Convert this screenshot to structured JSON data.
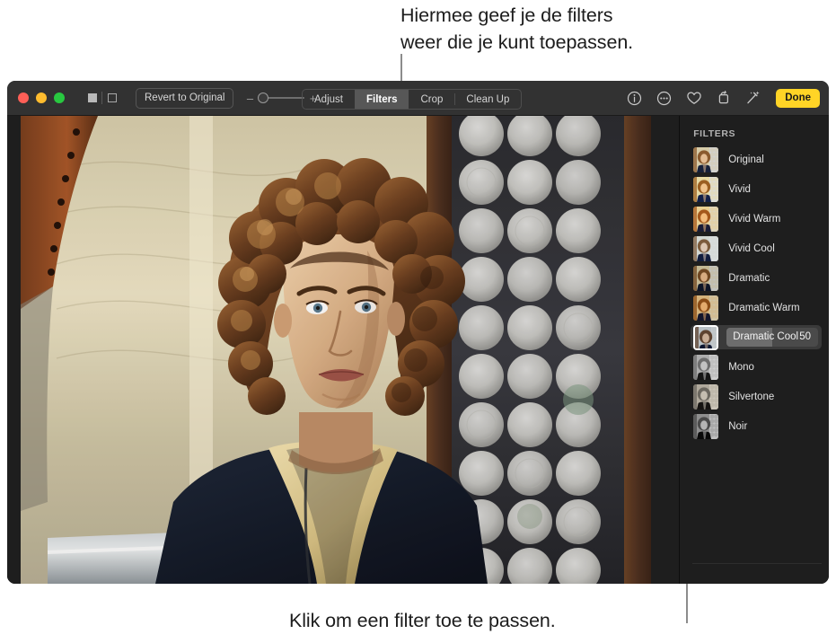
{
  "callouts": {
    "top": "Hiermee geef je de filters\nweer die je kunt toepassen.",
    "bottom": "Klik om een filter toe te passen."
  },
  "window": {
    "traffic_lights": {
      "close_label": "close",
      "minimize_label": "minimize",
      "zoom_label": "zoom"
    },
    "toolbar": {
      "view_single_label": "single-view",
      "view_split_label": "split-view",
      "zoom_out_label": "–",
      "zoom_in_label": "+",
      "zoom_value": 0,
      "revert_label": "Revert to Original",
      "segments": [
        {
          "label": "Adjust",
          "active": false
        },
        {
          "label": "Filters",
          "active": true
        },
        {
          "label": "Crop",
          "active": false
        },
        {
          "label": "Clean Up",
          "active": false
        }
      ],
      "icons": [
        {
          "name": "info-icon",
          "title": "Info"
        },
        {
          "name": "more-options-icon",
          "title": "More"
        },
        {
          "name": "heart-icon",
          "title": "Favorite"
        },
        {
          "name": "rotate-icon",
          "title": "Rotate"
        },
        {
          "name": "auto-enhance-icon",
          "title": "Auto Enhance"
        }
      ],
      "done_label": "Done"
    },
    "sidebar": {
      "header": "FILTERS",
      "filters": [
        {
          "label": "Original",
          "selected": false,
          "value": null
        },
        {
          "label": "Vivid",
          "selected": false,
          "value": null
        },
        {
          "label": "Vivid Warm",
          "selected": false,
          "value": null
        },
        {
          "label": "Vivid Cool",
          "selected": false,
          "value": null
        },
        {
          "label": "Dramatic",
          "selected": false,
          "value": null
        },
        {
          "label": "Dramatic Warm",
          "selected": false,
          "value": null
        },
        {
          "label": "Dramatic Cool",
          "selected": true,
          "value": 50
        },
        {
          "label": "Mono",
          "selected": false,
          "value": null
        },
        {
          "label": "Silvertone",
          "selected": false,
          "value": null
        },
        {
          "label": "Noir",
          "selected": false,
          "value": null
        }
      ]
    }
  },
  "colors": {
    "accent": "#ffd426",
    "toolbar_bg": "#323232",
    "window_bg": "#1e1e1e",
    "selected_row_bg": "#3a3a3a"
  }
}
